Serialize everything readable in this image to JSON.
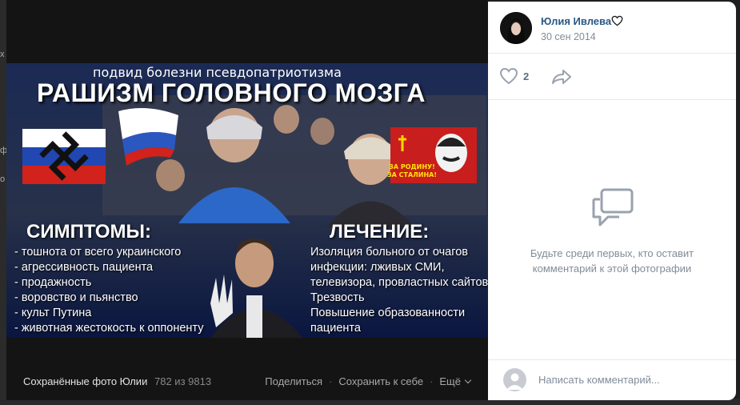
{
  "background": {
    "edge_letters": [
      "х",
      "ф",
      "о"
    ]
  },
  "photo": {
    "subtitle": "подвид болезни псевдопатриотизма",
    "headline": "РАШИЗМ ГОЛОВНОГО МОЗГА",
    "symptoms_title": "СИМПТОМЫ:",
    "symptoms": [
      "- тошнота от всего украинского",
      "- агрессивность пациента",
      "- продажность",
      "- воровство и пьянство",
      "- культ Путина",
      "- животная жестокость к оппоненту"
    ],
    "treatment_title": "ЛЕЧЕНИЕ:",
    "treatment": [
      "Изоляция больного от очагов",
      " инфекции: лживых СМИ,",
      " телевизора, провластных сайтов",
      "Трезвость",
      "Повышение образованности",
      " пациента"
    ],
    "poster_slogan_1": "ЗА РОДИНУ!",
    "poster_slogan_2": "ЗА СТАЛИНА!"
  },
  "footer": {
    "album": "Сохранённые фото Юлии",
    "counter": "782 из 9813",
    "share": "Поделиться",
    "save": "Сохранить к себе",
    "more": "Ещё"
  },
  "panel": {
    "author": "Юлия Ивлева",
    "date": "30 сен 2014",
    "likes": "2",
    "empty_text": "Будьте среди первых, кто оставит комментарий к этой фотографии",
    "comment_placeholder": "Написать комментарий..."
  },
  "colors": {
    "link": "#2a5885",
    "muted": "#818c99",
    "accent_icon": "#99a2ad"
  }
}
